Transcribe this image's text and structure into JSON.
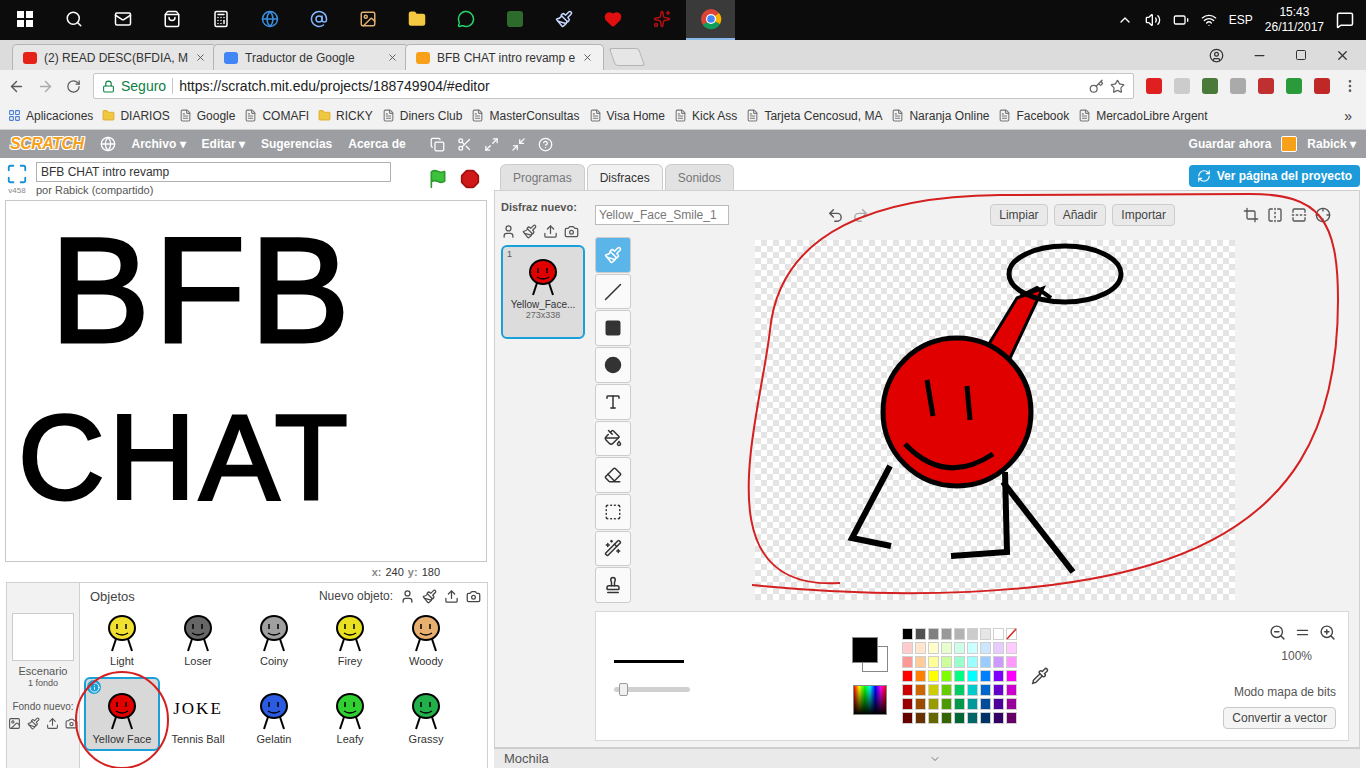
{
  "taskbar": {
    "apps": [
      {
        "selected": false
      },
      {
        "selected": false
      },
      {
        "selected": false
      },
      {
        "selected": false
      },
      {
        "selected": false
      },
      {
        "selected": false
      },
      {
        "selected": false
      },
      {
        "selected": false
      },
      {
        "selected": false
      },
      {
        "selected": false
      },
      {
        "selected": false
      },
      {
        "selected": false
      },
      {
        "selected": false
      },
      {
        "selected": false
      },
      {
        "selected": true
      }
    ],
    "language": "ESP",
    "time": "15:43",
    "date": "26/11/2017"
  },
  "browser": {
    "tabs": [
      {
        "label": "(2) READ DESC(BFDIA, M",
        "selected": false,
        "color": "#e62117"
      },
      {
        "label": "Traductor de Google",
        "selected": false,
        "color": "#4285f4"
      },
      {
        "label": "BFB CHAT intro revamp e",
        "selected": true,
        "color": "#f9a11b"
      }
    ],
    "security": "Seguro",
    "url": "https://scratch.mit.edu/projects/188749904/#editor",
    "bookmarks": [
      "Aplicaciones",
      "DIARIOS",
      "Google",
      "COMAFI",
      "RICKY",
      "Diners Club",
      "MasterConsultas",
      "Visa Home",
      "Kick Ass",
      "Tarjeta Cencosud, MA",
      "Naranja Online",
      "Facebook",
      "MercadoLibre Argent"
    ],
    "bookmarks_more": "»"
  },
  "scratch_menu": {
    "logo": "SCRATCH",
    "items": [
      "Archivo ▾",
      "Editar ▾",
      "Sugerencias",
      "Acerca de"
    ],
    "save": "Guardar ahora",
    "user": "Rabick ▾"
  },
  "project": {
    "title": "BFB CHAT intro revamp",
    "author": "por Rabick (compartido)",
    "version": "v458"
  },
  "stage": {
    "drawing_text": [
      "BFB",
      "CHAT"
    ],
    "x_label": "x:",
    "x": "240",
    "y_label": "y:",
    "y": "180"
  },
  "sprites_pane": {
    "title": "Objetos",
    "new_sprite": "Nuevo objeto:",
    "stage_label": "Escenario",
    "backdrops": "1 fondo",
    "new_backdrop": "Fondo nuevo:",
    "sprites": [
      {
        "name": "Light",
        "selected": false,
        "color": "#f0e030"
      },
      {
        "name": "Loser",
        "selected": false,
        "color": "#666666"
      },
      {
        "name": "Coiny",
        "selected": false,
        "color": "#a0a0a0"
      },
      {
        "name": "Firey",
        "selected": false,
        "color": "#e8e020"
      },
      {
        "name": "Woody",
        "selected": false,
        "color": "#e8b070"
      },
      {
        "name": "Yellow Face",
        "selected": true,
        "color": "#e00000"
      },
      {
        "name": "Tennis Ball",
        "selected": false,
        "color": "#ffffff",
        "thumb_text": "JOKE"
      },
      {
        "name": "Gelatin",
        "selected": false,
        "color": "#2a5be0"
      },
      {
        "name": "Leafy",
        "selected": false,
        "color": "#30d030"
      },
      {
        "name": "Grassy",
        "selected": false,
        "color": "#22b04a"
      }
    ]
  },
  "editor": {
    "tabs": [
      {
        "label": "Programas",
        "selected": false
      },
      {
        "label": "Disfraces",
        "selected": true
      },
      {
        "label": "Sonidos",
        "selected": false
      }
    ],
    "project_page": "Ver página del proyecto",
    "new_costume": "Disfraz nuevo:",
    "costumes": [
      {
        "number": "1",
        "name": "Yellow_Face...",
        "size": "273x338",
        "selected": true,
        "color": "#e00000"
      }
    ]
  },
  "paint": {
    "costume_name": "Yellow_Face_Smile_1",
    "actions": [
      "Limpiar",
      "Añadir",
      "Importar"
    ],
    "tools": [
      {
        "kind": "brush",
        "selected": true
      },
      {
        "kind": "line",
        "selected": false
      },
      {
        "kind": "rect",
        "selected": false
      },
      {
        "kind": "ellipse",
        "selected": false
      },
      {
        "kind": "text",
        "selected": false
      },
      {
        "kind": "fill",
        "selected": false
      },
      {
        "kind": "eraser",
        "selected": false
      },
      {
        "kind": "select",
        "selected": false
      },
      {
        "kind": "wand",
        "selected": false
      },
      {
        "kind": "stamp",
        "selected": false
      }
    ],
    "foreground": "#000000",
    "background": "#ffffff",
    "brush_level": 0.06,
    "palette": [
      [
        "#000000",
        "#505050",
        "#808080",
        "#999999",
        "#b3b3b3",
        "#cccccc",
        "#e6e6e6",
        "#ffffff"
      ],
      [
        "#ffcccc",
        "#ffe6cc",
        "#ffffcc",
        "#e6ffcc",
        "#ccffe6",
        "#ccffff",
        "#cce6ff",
        "#e6ccff",
        "#ffccff"
      ],
      [
        "#ff9999",
        "#ffcc99",
        "#ffff99",
        "#ccff99",
        "#99ffcc",
        "#99ffff",
        "#99ccff",
        "#cc99ff",
        "#ff99ff"
      ],
      [
        "#ff0000",
        "#ff8000",
        "#ffff00",
        "#80ff00",
        "#00ff80",
        "#00ffff",
        "#0080ff",
        "#8000ff",
        "#ff00ff"
      ],
      [
        "#cc0000",
        "#cc6600",
        "#cccc00",
        "#66cc00",
        "#00cc66",
        "#00cccc",
        "#0066cc",
        "#6600cc",
        "#cc00cc"
      ],
      [
        "#990000",
        "#994c00",
        "#999900",
        "#4c9900",
        "#00994c",
        "#009999",
        "#004c99",
        "#4c0099",
        "#990099"
      ],
      [
        "#660000",
        "#663300",
        "#666600",
        "#336600",
        "#006633",
        "#006666",
        "#003366",
        "#330066",
        "#660066"
      ]
    ],
    "zoom": "100%",
    "mode": "Modo mapa de bits",
    "convert": "Convertir a vector"
  },
  "backpack": "Mochila"
}
